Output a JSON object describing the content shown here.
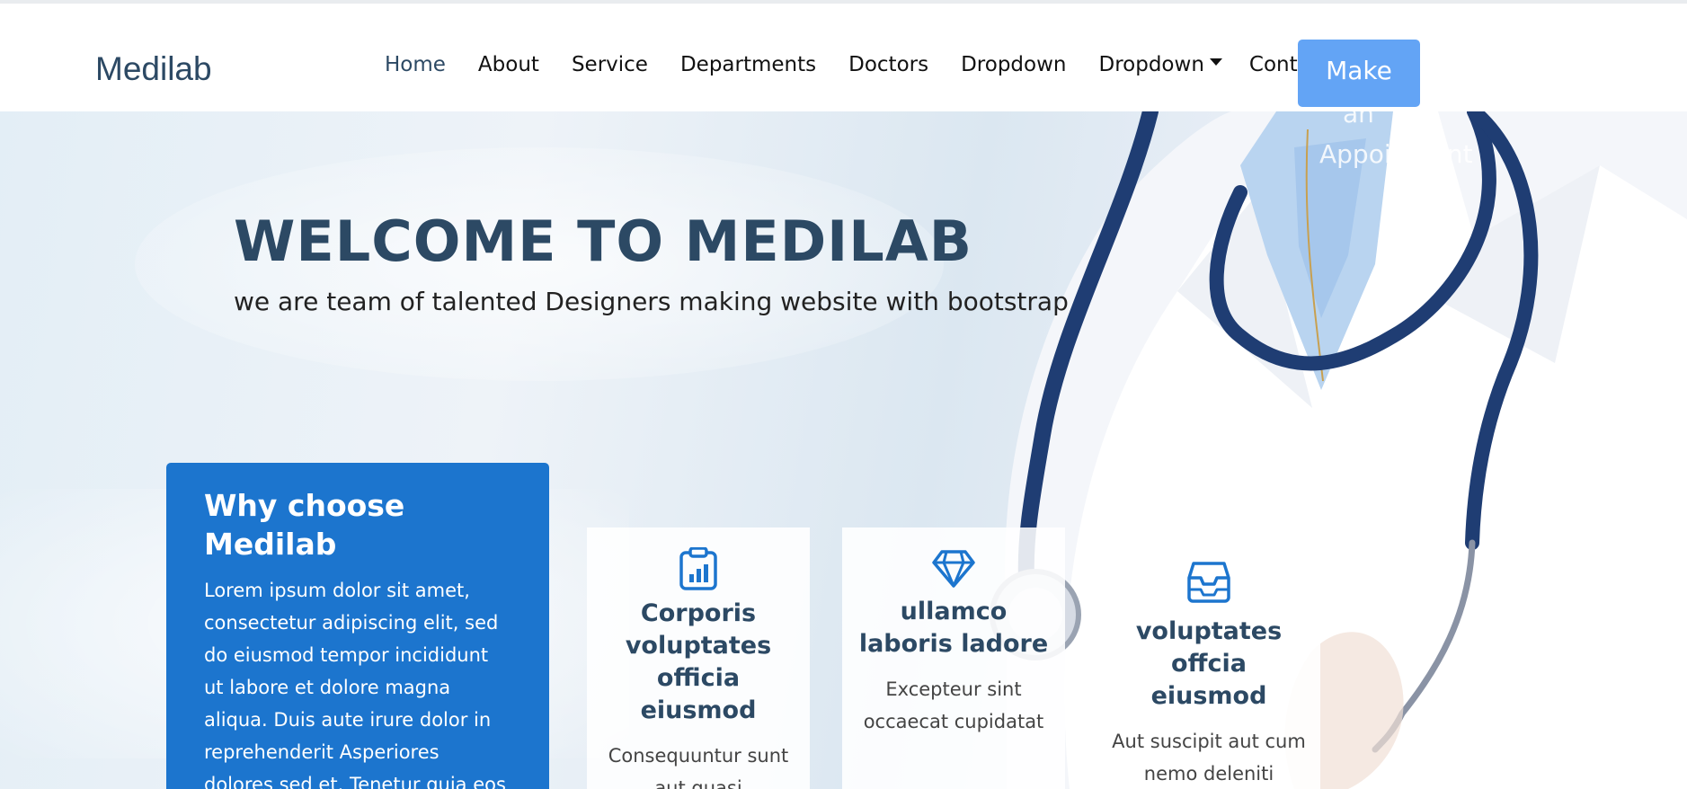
{
  "header": {
    "logo": "Medilab",
    "nav": [
      {
        "label": "Home",
        "active": true
      },
      {
        "label": "About"
      },
      {
        "label": "Service"
      },
      {
        "label": "Departments"
      },
      {
        "label": "Doctors"
      },
      {
        "label": "Dropdown"
      },
      {
        "label": "Dropdown",
        "has_caret": true
      },
      {
        "label": "Contact"
      }
    ],
    "appointment_button": {
      "line1": "Make",
      "line2": "an",
      "line3": "Appoinment"
    }
  },
  "hero": {
    "title": "WELCOME TO MEDILAB",
    "subtitle": "we are team of talented Designers making website with bootstrap"
  },
  "why_box": {
    "title": "Why choose Medilab",
    "text": "Lorem ipsum dolor sit amet, consectetur adipiscing elit, sed do eiusmod tempor incididunt ut labore et dolore magna aliqua. Duis aute irure dolor in reprehenderit Asperiores dolores sed et. Tenetur quia eos"
  },
  "cards": [
    {
      "icon": "clipboard-chart-icon",
      "title": "Corporis voluptates officia eiusmod",
      "text": "Consequuntur sunt aut quasi"
    },
    {
      "icon": "gem-icon",
      "title": "ullamco laboris ladore",
      "text": "Excepteur sint occaecat cupidatat"
    },
    {
      "icon": "inbox-icon",
      "title": "voluptates offcia eiusmod",
      "text": "Aut suscipit aut cum nemo deleniti"
    }
  ],
  "colors": {
    "brand": "#2c4964",
    "primary": "#1c75ce",
    "button": "#63a4f5"
  }
}
